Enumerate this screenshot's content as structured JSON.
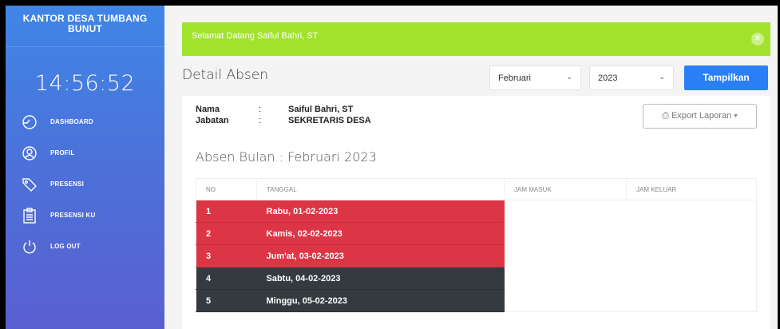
{
  "sidebar": {
    "brand": "KANTOR DESA TUMBANG BUNUT",
    "clock": "14:56:52",
    "items": [
      {
        "label": "DASHBOARD",
        "icon": "gauge-icon"
      },
      {
        "label": "PROFIL",
        "icon": "user-icon"
      },
      {
        "label": "PRESENSI",
        "icon": "tag-icon"
      },
      {
        "label": "PRESENSI KU",
        "icon": "clipboard-icon"
      },
      {
        "label": "LOG OUT",
        "icon": "power-icon"
      }
    ]
  },
  "alert": {
    "message": "Selamat Datang Saiful Bahri, ST",
    "close": "✕"
  },
  "header": {
    "title": "Detail Absen",
    "month_select": "Februari",
    "year_select": "2023",
    "show_button": "Tampilkan"
  },
  "profile": {
    "name_label": "Nama",
    "name_value": "Saiful Bahri, ST",
    "position_label": "Jabatan",
    "position_value": "SEKRETARIS DESA",
    "colon": ":"
  },
  "export_button": "Export Laporan",
  "month_title": "Absen Bulan : Februari 2023",
  "table": {
    "headers": [
      "NO",
      "TANGGAL",
      "JAM MASUK",
      "JAM KELUAR"
    ],
    "rows": [
      {
        "no": "1",
        "date": "Rabu, 01-02-2023",
        "status": "red"
      },
      {
        "no": "2",
        "date": "Kamis, 02-02-2023",
        "status": "red"
      },
      {
        "no": "3",
        "date": "Jum'at, 03-02-2023",
        "status": "red"
      },
      {
        "no": "4",
        "date": "Sabtu, 04-02-2023",
        "status": "dark"
      },
      {
        "no": "5",
        "date": "Minggu, 05-02-2023",
        "status": "dark"
      }
    ]
  },
  "colors": {
    "alert": "#a1e32c",
    "primary": "#2a7ff5",
    "absent_red": "#dc3545",
    "weekend_dark": "#343a40"
  }
}
